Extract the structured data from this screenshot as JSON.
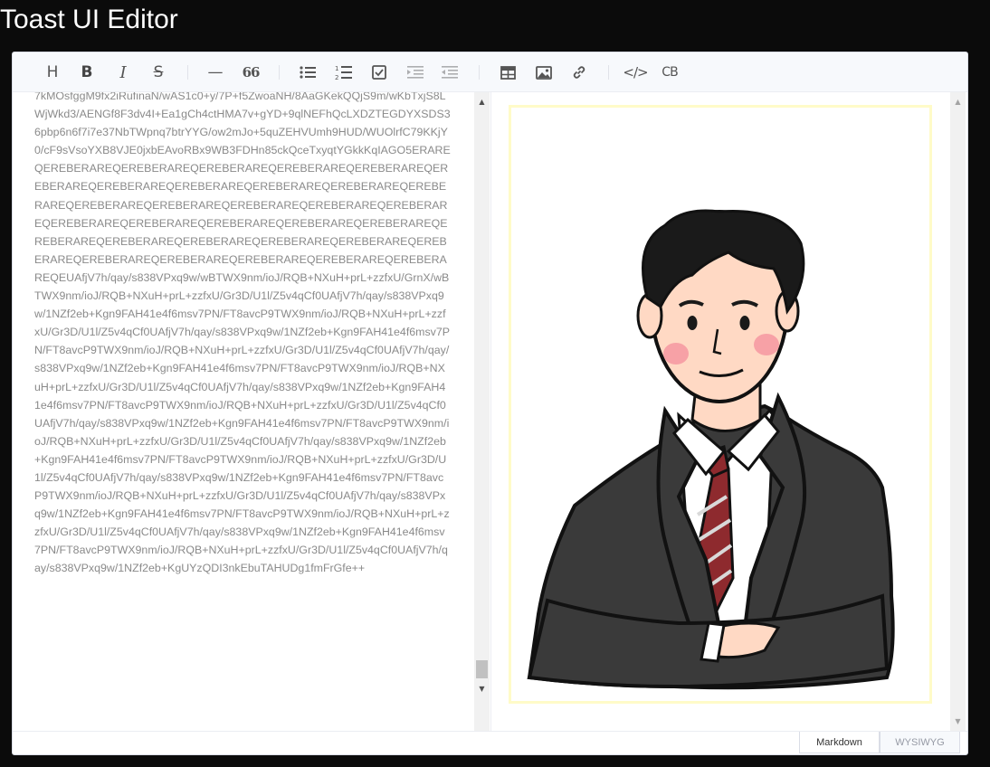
{
  "page": {
    "title": "Toast UI Editor"
  },
  "toolbar": {
    "heading": "H",
    "bold": "B",
    "italic": "I",
    "strike": "S",
    "hr": "—",
    "quote": "66",
    "codeblock": "CB",
    "code": "</>"
  },
  "markdown": {
    "source": "7kMOsfggM9fx2iRufinaN/wAS1c0+y/7P+f5ZwoaNH/8AaGKekQQjS9m/wKbTxjS8LWjWkd3/AENGf8F3dv4I+Ea1gCh4ctHMA7v+gYD+9qlNEFhQcLXDZTEGDYXSDS36pbp6n6f7i7e37NbTWpnq7btrYYG/ow2mJo+5quZEHVUmh9HUD/WUOlrfC79KKjY0/cF9sVsoYXB8VJE0jxbEAvoRBx9WB3FDHn85ckQceTxyqtYGkkKqIAGO5ERAREQEREBERAREQEREBERAREQEREBERAREQEREBERAREQEREBERAREQEREBERAREQEREBERAREQEREBERAREQEREBERAREQEREBERAREQEREBERAREQEREBERAREQEREBERAREQEREBERAREQEREBERAREQEREBERAREQEREBERAREQEREBERAREQEREBERAREQEREBERAREQEREBERAREQEREBERAREQEREBERAREQEREBERAREQEREBERAREQEREBERAREQEREBERAREQEREBERAREQEREBERAREQEREBERAREQEREBERAREQEREBERAREQEUAfjV7h/qay/s838VPxq9w/wBTWX9nm/ioJ/RQB+NXuH+prL+zzfxU/GrnX/wBTWX9nm/ioJ/RQB+NXuH+prL+zzfxU/Gr3D/U1l/Z5v4qCf0UAfjV7h/qay/s838VPxq9w/1NZf2eb+Kgn9FAH41e4f6msv7PN/FT8avcP9TWX9nm/ioJ/RQB+NXuH+prL+zzfxU/Gr3D/U1l/Z5v4qCf0UAfjV7h/qay/s838VPxq9w/1NZf2eb+Kgn9FAH41e4f6msv7PN/FT8avcP9TWX9nm/ioJ/RQB+NXuH+prL+zzfxU/Gr3D/U1l/Z5v4qCf0UAfjV7h/qay/s838VPxq9w/1NZf2eb+Kgn9FAH41e4f6msv7PN/FT8avcP9TWX9nm/ioJ/RQB+NXuH+prL+zzfxU/Gr3D/U1l/Z5v4qCf0UAfjV7h/qay/s838VPxq9w/1NZf2eb+Kgn9FAH41e4f6msv7PN/FT8avcP9TWX9nm/ioJ/RQB+NXuH+prL+zzfxU/Gr3D/U1l/Z5v4qCf0UAfjV7h/qay/s838VPxq9w/1NZf2eb+Kgn9FAH41e4f6msv7PN/FT8avcP9TWX9nm/ioJ/RQB+NXuH+prL+zzfxU/Gr3D/U1l/Z5v4qCf0UAfjV7h/qay/s838VPxq9w/1NZf2eb+Kgn9FAH41e4f6msv7PN/FT8avcP9TWX9nm/ioJ/RQB+NXuH+prL+zzfxU/Gr3D/U1l/Z5v4qCf0UAfjV7h/qay/s838VPxq9w/1NZf2eb+Kgn9FAH41e4f6msv7PN/FT8avcP9TWX9nm/ioJ/RQB+NXuH+prL+zzfxU/Gr3D/U1l/Z5v4qCf0UAfjV7h/qay/s838VPxq9w/1NZf2eb+Kgn9FAH41e4f6msv7PN/FT8avcP9TWX9nm/ioJ/RQB+NXuH+prL+zzfxU/Gr3D/U1l/Z5v4qCf0UAfjV7h/qay/s838VPxq9w/1NZf2eb+Kgn9FAH41e4f6msv7PN/FT8avcP9TWX9nm/ioJ/RQB+NXuH+prL+zzfxU/Gr3D/U1l/Z5v4qCf0UAfjV7h/qay/s838VPxq9w/1NZf2eb+KgUYzQDI3nkEbuTAHUDg1fmFrGfe++"
  },
  "modes": {
    "markdown": "Markdown",
    "wysiwyg": "WYSIWYG"
  },
  "colors": {
    "accent": "#4b96e6",
    "border": "#dadde6",
    "frame": "#fffbc8"
  },
  "icons": {
    "heading": "heading-icon",
    "bold": "bold-icon",
    "italic": "italic-icon",
    "strike": "strike-icon",
    "hr": "horizontal-line-icon",
    "quote": "quote-icon",
    "ul": "bullet-list-icon",
    "ol": "ordered-list-icon",
    "task": "task-list-icon",
    "indent": "indent-icon",
    "outdent": "outdent-icon",
    "table": "table-icon",
    "image": "image-icon",
    "link": "link-icon",
    "code": "code-icon",
    "codeblock": "codeblock-icon"
  }
}
